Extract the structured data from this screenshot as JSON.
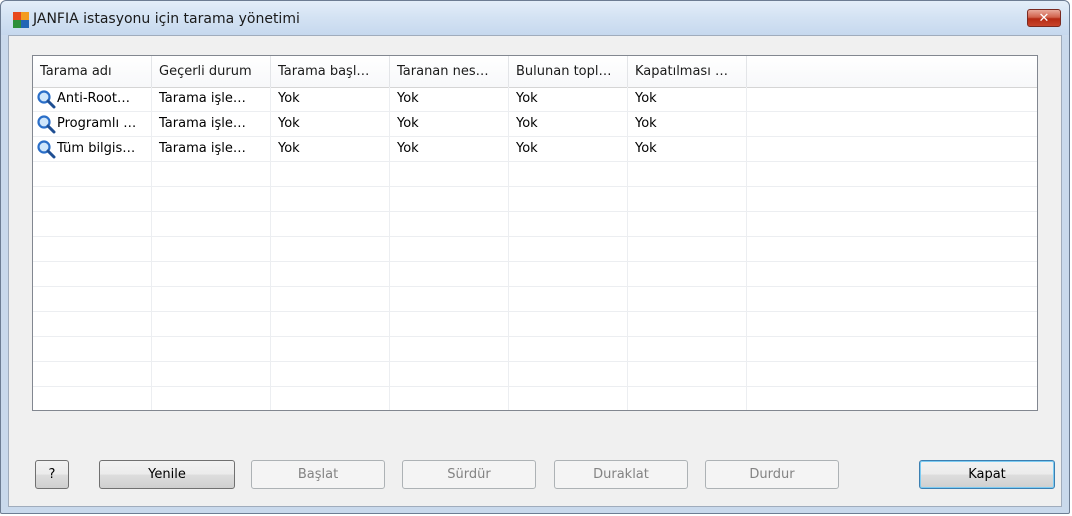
{
  "window": {
    "title": "JANFIA istasyonu için tarama yönetimi",
    "close_label": "✕"
  },
  "table": {
    "columns": [
      "Tarama adı",
      "Geçerli durum",
      "Tarama başl…",
      "Taranan nes…",
      "Bulunan topl…",
      "Kapatılması …"
    ],
    "rows": [
      [
        "Anti-Root…",
        "Tarama işle…",
        "Yok",
        "Yok",
        "Yok",
        "Yok"
      ],
      [
        "Programlı …",
        "Tarama işle…",
        "Yok",
        "Yok",
        "Yok",
        "Yok"
      ],
      [
        "Tüm bilgis…",
        "Tarama işle…",
        "Yok",
        "Yok",
        "Yok",
        "Yok"
      ]
    ],
    "row_icon": "magnifier-icon"
  },
  "buttons": {
    "help": "?",
    "refresh": "Yenile",
    "start": "Başlat",
    "resume": "Sürdür",
    "pause": "Duraklat",
    "stop": "Durdur",
    "close": "Kapat"
  },
  "colors": {
    "accent": "#2a6ec8",
    "close_red": "#c8442b"
  }
}
